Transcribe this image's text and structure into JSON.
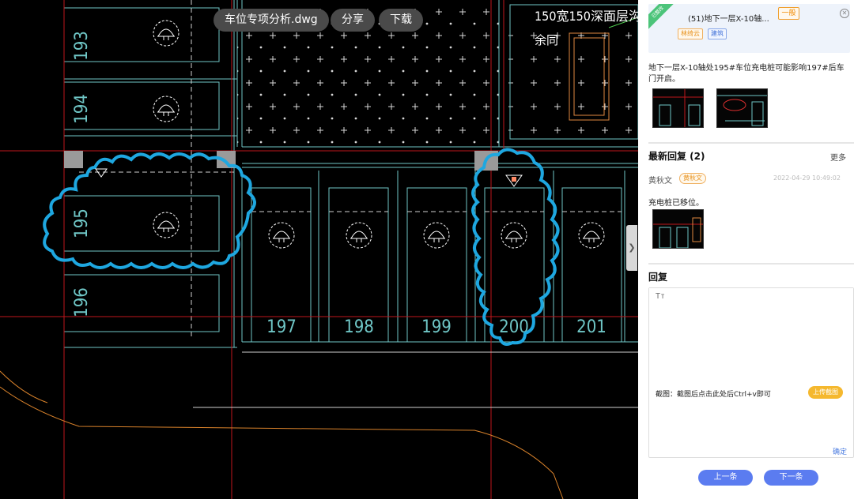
{
  "toolbar": {
    "file_name": "车位专项分析.dwg",
    "share_label": "分享",
    "download_label": "下载"
  },
  "drawing": {
    "note_line1": "150宽150深面层沟",
    "note_line2": "余同",
    "space_numbers": [
      "193",
      "194",
      "195",
      "196",
      "197",
      "198",
      "199",
      "200",
      "201"
    ]
  },
  "panel": {
    "issue": {
      "ribbon": "已整改",
      "title": "(51)地下一层X-10轴...",
      "level": "一般",
      "tags": [
        "林绮云",
        "建筑"
      ]
    },
    "description": "地下一层X-10轴处195#车位充电桩可能影响197#后车门开启。",
    "latest_reply": {
      "heading": "最新回复 (2)",
      "more": "更多",
      "user": "黄秋文",
      "user_badge": "黄秋文",
      "time": "2022-04-29 10:49:02",
      "text": "充电桩已移位。"
    },
    "reply_form": {
      "heading": "回复",
      "placeholder": "Tт",
      "screenshot_label": "截图：截图后点击此处后Ctrl+v即可",
      "upload_label": "上传截图",
      "confirm_label": "确定"
    },
    "prev_label": "上一条",
    "next_label": "下一条"
  },
  "colors": {
    "cad_background": "#000000",
    "cad_red": "#c0161b",
    "cad_cyan": "#6fc6c6",
    "revision_cloud": "#1ea7e0",
    "nav_button": "#5b7cf0",
    "upload_button": "#f5b82e"
  }
}
